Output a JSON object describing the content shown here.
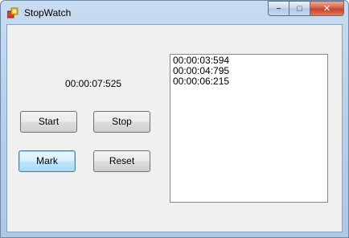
{
  "window": {
    "title": "StopWatch"
  },
  "caption": {
    "minimize_icon": "minimize-icon",
    "maximize_icon": "maximize-icon",
    "close_icon": "close-icon",
    "minimize_glyph": "–",
    "maximize_glyph": "□",
    "close_glyph": "✕"
  },
  "elapsed_time": "00:00:07:525",
  "buttons": {
    "start": "Start",
    "stop": "Stop",
    "mark": "Mark",
    "reset": "Reset"
  },
  "marks": [
    "00:00:03:594",
    "00:00:04:795",
    "00:00:06:215"
  ],
  "colors": {
    "close_button": "#c7432a",
    "focus_border": "#3c7fb1",
    "client_background": "#f0f0f0"
  }
}
